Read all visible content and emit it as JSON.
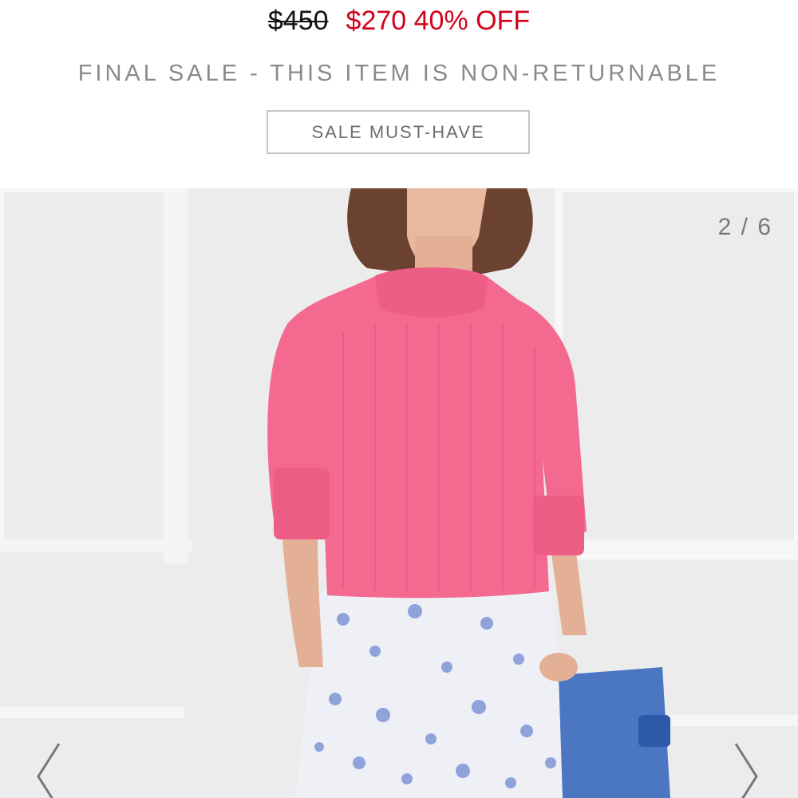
{
  "price": {
    "original": "$450",
    "sale": "$270",
    "discount": "40% OFF"
  },
  "notice": "FINAL SALE - THIS ITEM IS NON-RETURNABLE",
  "badge": "SALE MUST-HAVE",
  "gallery": {
    "counter": "2 / 6",
    "prev_icon": "chevron-left-icon",
    "next_icon": "chevron-right-icon"
  },
  "colors": {
    "sale_red": "#d0021b",
    "sweater_pink": "#f4698f",
    "clutch_blue": "#4a76c2"
  }
}
